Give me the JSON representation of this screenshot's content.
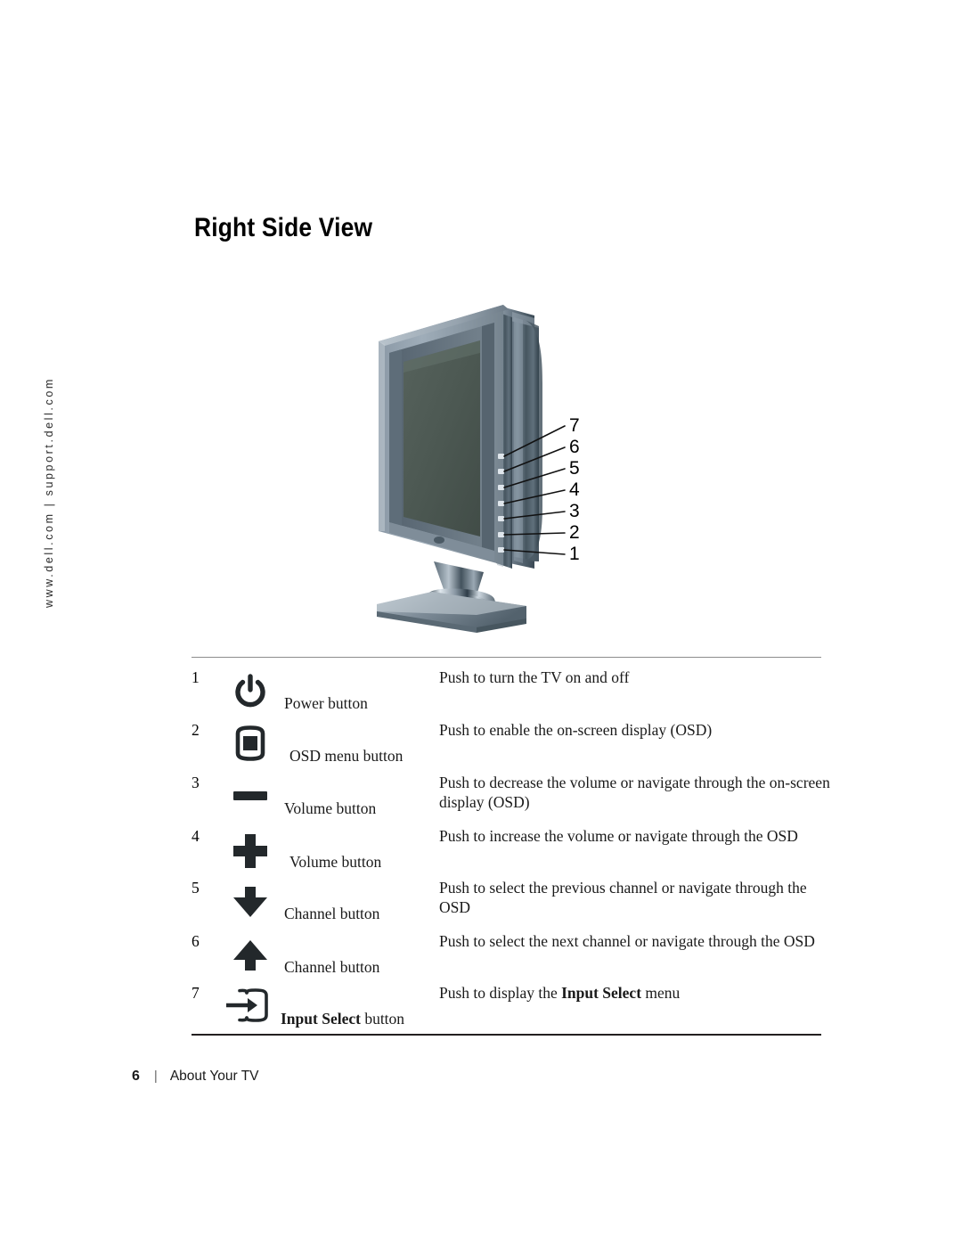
{
  "side_rail": {
    "text": "www.dell.com | support.dell.com"
  },
  "heading": {
    "title": "Right Side View"
  },
  "figure": {
    "alt": "dell-lcd-tv-right-side-view",
    "callouts": [
      {
        "number": "7"
      },
      {
        "number": "6"
      },
      {
        "number": "5"
      },
      {
        "number": "4"
      },
      {
        "number": "3"
      },
      {
        "number": "2"
      },
      {
        "number": "1"
      }
    ],
    "colors": {
      "bezel_light": "#9aa7b4",
      "bezel_mid": "#7b8b99",
      "bezel_dark": "#56646f",
      "screen": "#4b5751",
      "side_panel": "#46555f",
      "chrome_light": "#e8edf1",
      "chrome_dark": "#6d7d89",
      "leader_line": "#111111"
    }
  },
  "table": {
    "rows": [
      {
        "number": "1",
        "icon": "power-icon",
        "label": "Power button",
        "label_bold": "",
        "desc_prefix": "Push to turn the TV on and off",
        "desc_bold": "",
        "desc_suffix": ""
      },
      {
        "number": "2",
        "icon": "osd-menu-icon",
        "label": "OSD menu button",
        "label_bold": "",
        "desc_prefix": "Push to enable the on-screen display (OSD)",
        "desc_bold": "",
        "desc_suffix": ""
      },
      {
        "number": "3",
        "icon": "minus-icon",
        "label": "Volume button",
        "label_bold": "",
        "desc_prefix": "Push to decrease the volume or navigate through the on-screen display (OSD)",
        "desc_bold": "",
        "desc_suffix": ""
      },
      {
        "number": "4",
        "icon": "plus-icon",
        "label": "Volume button",
        "label_bold": "",
        "desc_prefix": "Push to increase the volume or navigate through the OSD",
        "desc_bold": "",
        "desc_suffix": ""
      },
      {
        "number": "5",
        "icon": "arrow-down-icon",
        "label": "Channel button",
        "label_bold": "",
        "desc_prefix": "Push to select the previous channel or navigate through the OSD",
        "desc_bold": "",
        "desc_suffix": ""
      },
      {
        "number": "6",
        "icon": "arrow-up-icon",
        "label": "Channel button",
        "label_bold": "",
        "desc_prefix": "Push to select the next channel or navigate through the OSD",
        "desc_bold": "",
        "desc_suffix": ""
      },
      {
        "number": "7",
        "icon": "input-select-icon",
        "label": " button",
        "label_bold": "Input Select",
        "desc_prefix": "Push to display the ",
        "desc_bold": "Input Select",
        "desc_suffix": " menu"
      }
    ]
  },
  "footer": {
    "page_number": "6",
    "separator": "|",
    "section": "About Your TV"
  }
}
